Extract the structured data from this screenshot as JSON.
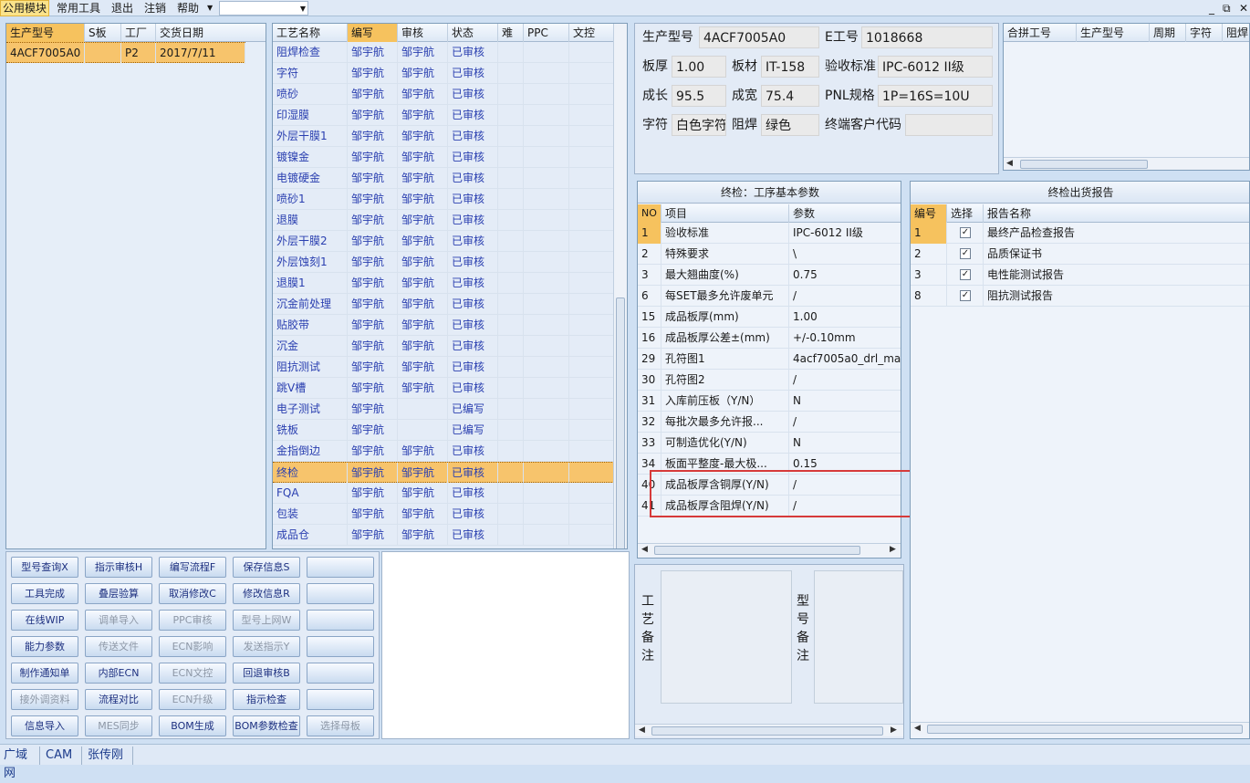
{
  "menu": {
    "items": [
      "公用模块",
      "常用工具",
      "退出",
      "注销",
      "帮助"
    ],
    "combo_value": "",
    "window_controls": [
      "_",
      "⧉",
      "✕"
    ]
  },
  "orders": {
    "headers": [
      "生产型号",
      "S板",
      "工厂",
      "交货日期"
    ],
    "rows": [
      {
        "model": "4ACF7005A0",
        "s": "",
        "factory": "P2",
        "date": "2017/7/11"
      }
    ]
  },
  "process": {
    "headers": [
      "工艺名称",
      "编写",
      "审核",
      "状态",
      "难",
      "PPC",
      "文控"
    ],
    "rows": [
      {
        "name": "阻焊检查",
        "writer": "邹宇航",
        "reviewer": "邹宇航",
        "status": "已审核"
      },
      {
        "name": "字符",
        "writer": "邹宇航",
        "reviewer": "邹宇航",
        "status": "已审核"
      },
      {
        "name": "喷砂",
        "writer": "邹宇航",
        "reviewer": "邹宇航",
        "status": "已审核"
      },
      {
        "name": "印湿膜",
        "writer": "邹宇航",
        "reviewer": "邹宇航",
        "status": "已审核"
      },
      {
        "name": "外层干膜1",
        "writer": "邹宇航",
        "reviewer": "邹宇航",
        "status": "已审核"
      },
      {
        "name": "镀镍金",
        "writer": "邹宇航",
        "reviewer": "邹宇航",
        "status": "已审核"
      },
      {
        "name": "电镀硬金",
        "writer": "邹宇航",
        "reviewer": "邹宇航",
        "status": "已审核"
      },
      {
        "name": "喷砂1",
        "writer": "邹宇航",
        "reviewer": "邹宇航",
        "status": "已审核"
      },
      {
        "name": "退膜",
        "writer": "邹宇航",
        "reviewer": "邹宇航",
        "status": "已审核"
      },
      {
        "name": "外层干膜2",
        "writer": "邹宇航",
        "reviewer": "邹宇航",
        "status": "已审核"
      },
      {
        "name": "外层蚀刻1",
        "writer": "邹宇航",
        "reviewer": "邹宇航",
        "status": "已审核"
      },
      {
        "name": "退膜1",
        "writer": "邹宇航",
        "reviewer": "邹宇航",
        "status": "已审核"
      },
      {
        "name": "沉金前处理",
        "writer": "邹宇航",
        "reviewer": "邹宇航",
        "status": "已审核"
      },
      {
        "name": "贴胶带",
        "writer": "邹宇航",
        "reviewer": "邹宇航",
        "status": "已审核"
      },
      {
        "name": "沉金",
        "writer": "邹宇航",
        "reviewer": "邹宇航",
        "status": "已审核"
      },
      {
        "name": "阻抗测试",
        "writer": "邹宇航",
        "reviewer": "邹宇航",
        "status": "已审核"
      },
      {
        "name": "跳V槽",
        "writer": "邹宇航",
        "reviewer": "邹宇航",
        "status": "已审核"
      },
      {
        "name": "电子测试",
        "writer": "邹宇航",
        "reviewer": "",
        "status": "已编写"
      },
      {
        "name": "铣板",
        "writer": "邹宇航",
        "reviewer": "",
        "status": "已编写"
      },
      {
        "name": "金指倒边",
        "writer": "邹宇航",
        "reviewer": "邹宇航",
        "status": "已审核"
      },
      {
        "name": "终检",
        "writer": "邹宇航",
        "reviewer": "邹宇航",
        "status": "已审核"
      },
      {
        "name": "FQA",
        "writer": "邹宇航",
        "reviewer": "邹宇航",
        "status": "已审核"
      },
      {
        "name": "包装",
        "writer": "邹宇航",
        "reviewer": "邹宇航",
        "status": "已审核"
      },
      {
        "name": "成品仓",
        "writer": "邹宇航",
        "reviewer": "邹宇航",
        "status": "已审核"
      }
    ]
  },
  "buttons": [
    [
      "型号查询X",
      "指示审核H",
      "编写流程F",
      "保存信息S",
      ""
    ],
    [
      "工具完成",
      "叠层验算",
      "取消修改C",
      "修改信息R",
      ""
    ],
    [
      "在线WIP",
      "调单导入",
      "PPC审核",
      "型号上网W",
      ""
    ],
    [
      "能力参数",
      "传送文件",
      "ECN影响",
      "发送指示Y",
      ""
    ],
    [
      "制作通知单",
      "内部ECN",
      "ECN文控",
      "回退审核B",
      ""
    ],
    [
      "接外调资料",
      "流程对比",
      "ECN升级",
      "指示检查",
      ""
    ],
    [
      "信息导入",
      "MES同步",
      "BOM生成",
      "BOM参数检查",
      "选择母板"
    ]
  ],
  "info": {
    "model_label": "生产型号",
    "model_value": "4ACF7005A0",
    "eno_label": "E工号",
    "eno_value": "1018668",
    "thickness_label": "板厚",
    "thickness_value": "1.00",
    "material_label": "板材",
    "material_value": "IT-158",
    "standard_label": "验收标准",
    "standard_value": "IPC-6012 II级",
    "length_label": "成长",
    "length_value": "95.5",
    "width_label": "成宽",
    "width_value": "75.4",
    "pnl_label": "PNL规格",
    "pnl_value": "1P=16S=10U",
    "char_label": "字符",
    "char_value": "白色字符",
    "mask_label": "阻焊",
    "mask_value": "绿色",
    "customer_label": "终端客户代码",
    "customer_value": ""
  },
  "combine": {
    "headers": [
      "合拼工号",
      "生产型号",
      "周期",
      "字符",
      "阻焊"
    ]
  },
  "params": {
    "title": "终检：工序基本参数",
    "headers": [
      "NO",
      "项目",
      "参数"
    ],
    "rows": [
      {
        "no": "1",
        "item": "验收标准",
        "value": "IPC-6012 II级"
      },
      {
        "no": "2",
        "item": "特殊要求",
        "value": "\\"
      },
      {
        "no": "3",
        "item": "最大翘曲度(%)",
        "value": "0.75"
      },
      {
        "no": "6",
        "item": "每SET最多允许废单元",
        "value": "/"
      },
      {
        "no": "15",
        "item": "成品板厚(mm)",
        "value": "1.00"
      },
      {
        "no": "16",
        "item": "成品板厚公差±(mm)",
        "value": "+/-0.10mm"
      },
      {
        "no": "29",
        "item": "孔符图1",
        "value": "4acf7005a0_drl_ma"
      },
      {
        "no": "30",
        "item": "孔符图2",
        "value": "/"
      },
      {
        "no": "31",
        "item": "入库前压板（Y/N）",
        "value": "N"
      },
      {
        "no": "32",
        "item": "每批次最多允许报...",
        "value": "/"
      },
      {
        "no": "33",
        "item": "可制造优化(Y/N)",
        "value": "N"
      },
      {
        "no": "34",
        "item": "板面平整度-最大极...",
        "value": "0.15"
      },
      {
        "no": "40",
        "item": "成品板厚含铜厚(Y/N)",
        "value": "/"
      },
      {
        "no": "41",
        "item": "成品板厚含阻焊(Y/N)",
        "value": "/"
      }
    ]
  },
  "report": {
    "title": "终检出货报告",
    "headers": [
      "编号",
      "选择",
      "报告名称"
    ],
    "rows": [
      {
        "no": "1",
        "checked": "✓",
        "name": "最终产品检查报告"
      },
      {
        "no": "2",
        "checked": "✓",
        "name": "品质保证书"
      },
      {
        "no": "3",
        "checked": "✓",
        "name": "电性能测试报告"
      },
      {
        "no": "8",
        "checked": "✓",
        "name": "阻抗测试报告"
      }
    ]
  },
  "notes": {
    "process_label": "工艺备注",
    "model_label": "型号备注"
  },
  "status": {
    "items": [
      "广域网",
      "CAM",
      "张传刚"
    ]
  },
  "colors": {
    "selection": "#f7c46c",
    "highlight_box": "#d63a3a",
    "link_blue": "#2a3fb0"
  }
}
